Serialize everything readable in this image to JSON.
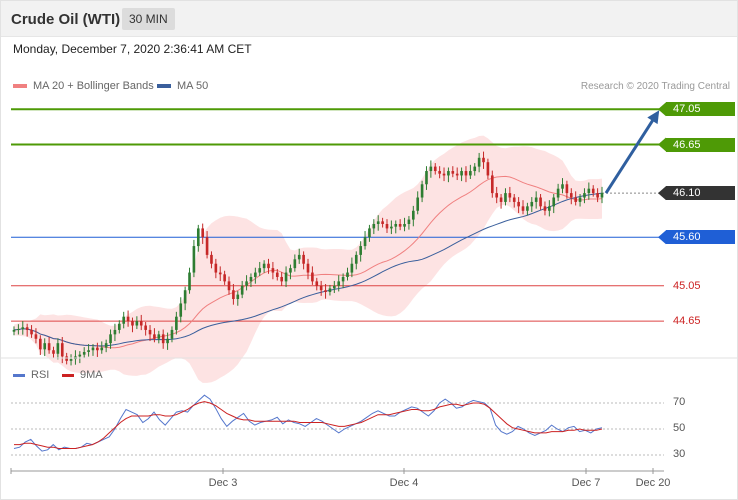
{
  "header": {
    "title": "Crude Oil (WTI)",
    "timeframe": "30 MIN"
  },
  "datetime": "Monday, December 7, 2020 2:36:41 AM CET",
  "legend": {
    "ma20": "MA 20 + Bollinger Bands",
    "ma50": "MA 50",
    "rsi": "RSI",
    "ma9": "9MA"
  },
  "copyright": "Research © 2020 Trading Central",
  "colors": {
    "resistance": "#4e9a06",
    "support": "#1f5fd6",
    "current": "#333333",
    "minor": "#dd4444",
    "ma20": "#f08080",
    "ma50": "#3a5f9c",
    "rsi": "#5577cc",
    "ma9": "#cc2222",
    "arrow": "#2f5f9f",
    "band": "#fde3e3",
    "up": "#2e7d32",
    "down": "#c62828"
  },
  "chart_data": [
    {
      "type": "candlestick",
      "ylim": [
        44.3,
        47.2
      ],
      "x_ticks": [
        "Dec 3",
        "Dec 4",
        "Dec 7",
        "Dec 20"
      ],
      "levels": [
        {
          "label": "47.05",
          "value": 47.05,
          "kind": "resistance"
        },
        {
          "label": "46.65",
          "value": 46.65,
          "kind": "resistance"
        },
        {
          "label": "46.10",
          "value": 46.1,
          "kind": "current"
        },
        {
          "label": "45.60",
          "value": 45.6,
          "kind": "support"
        },
        {
          "label": "45.05",
          "value": 45.05,
          "kind": "minor"
        },
        {
          "label": "44.65",
          "value": 44.65,
          "kind": "minor"
        }
      ],
      "close": [
        44.55,
        44.56,
        44.58,
        44.55,
        44.5,
        44.45,
        44.33,
        44.4,
        44.32,
        44.28,
        44.4,
        44.25,
        44.2,
        44.22,
        44.25,
        44.27,
        44.3,
        44.32,
        44.35,
        44.32,
        44.35,
        44.4,
        44.5,
        44.55,
        44.62,
        44.7,
        44.65,
        44.6,
        44.65,
        44.6,
        44.55,
        44.5,
        44.45,
        44.5,
        44.4,
        44.45,
        44.55,
        44.7,
        44.85,
        45.0,
        45.2,
        45.5,
        45.7,
        45.6,
        45.4,
        45.3,
        45.2,
        45.18,
        45.1,
        45.0,
        44.9,
        44.95,
        45.05,
        45.1,
        45.15,
        45.2,
        45.25,
        45.3,
        45.25,
        45.2,
        45.15,
        45.1,
        45.2,
        45.25,
        45.35,
        45.4,
        45.3,
        45.2,
        45.1,
        45.05,
        45.0,
        44.98,
        45.02,
        45.05,
        45.1,
        45.15,
        45.2,
        45.3,
        45.4,
        45.5,
        45.6,
        45.7,
        45.75,
        45.78,
        45.75,
        45.7,
        45.72,
        45.75,
        45.72,
        45.75,
        45.8,
        45.9,
        46.05,
        46.2,
        46.35,
        46.4,
        46.35,
        46.32,
        46.3,
        46.35,
        46.32,
        46.3,
        46.35,
        46.3,
        46.35,
        46.4,
        46.5,
        46.45,
        46.3,
        46.1,
        46.05,
        46.0,
        46.1,
        46.05,
        46.0,
        45.95,
        45.9,
        45.95,
        46.0,
        46.05,
        45.95,
        45.9,
        45.95,
        46.05,
        46.15,
        46.2,
        46.1,
        46.05,
        46.0,
        46.05,
        46.1,
        46.15,
        46.1,
        46.05,
        46.1
      ]
    },
    {
      "type": "line",
      "ylim": [
        20,
        80
      ],
      "y_ticks": [
        30,
        50,
        70
      ],
      "series": [
        {
          "name": "RSI",
          "values": [
            35,
            36,
            40,
            42,
            37,
            33,
            34,
            38,
            34,
            36,
            35,
            35,
            36,
            39,
            38,
            40,
            42,
            44,
            50,
            58,
            65,
            63,
            61,
            55,
            58,
            63,
            57,
            53,
            58,
            63,
            64,
            63,
            68,
            72,
            76,
            73,
            66,
            58,
            52,
            56,
            59,
            62,
            56,
            53,
            55,
            56,
            57,
            59,
            54,
            57,
            55,
            54,
            52,
            55,
            58,
            56,
            53,
            50,
            47,
            50,
            52,
            54,
            56,
            59,
            62,
            64,
            62,
            60,
            60,
            63,
            65,
            67,
            66,
            63,
            60,
            64,
            70,
            73,
            70,
            66,
            67,
            70,
            72,
            71,
            70,
            66,
            53,
            48,
            46,
            48,
            52,
            50,
            47,
            45,
            47,
            49,
            53,
            50,
            48,
            51,
            52,
            48,
            49,
            47,
            50,
            51
          ]
        },
        {
          "name": "9MA",
          "values": [
            38,
            38,
            39,
            39,
            38,
            37,
            36,
            36,
            35,
            35,
            35,
            35,
            36,
            37,
            38,
            40,
            43,
            47,
            51,
            55,
            58,
            60,
            60,
            60,
            60,
            61,
            61,
            60,
            60,
            61,
            63,
            65,
            68,
            70,
            71,
            70,
            68,
            65,
            62,
            60,
            58,
            57,
            57,
            56,
            56,
            56,
            56,
            56,
            56,
            56,
            56,
            55,
            55,
            55,
            55,
            55,
            54,
            53,
            52,
            52,
            53,
            54,
            55,
            57,
            59,
            61,
            61,
            61,
            62,
            63,
            64,
            65,
            65,
            64,
            64,
            65,
            67,
            68,
            69,
            69,
            68,
            69,
            70,
            70,
            69,
            66,
            62,
            58,
            54,
            51,
            50,
            49,
            48,
            47,
            47,
            47,
            48,
            48,
            48,
            49,
            49,
            50,
            49,
            49,
            49,
            50
          ]
        }
      ]
    }
  ]
}
